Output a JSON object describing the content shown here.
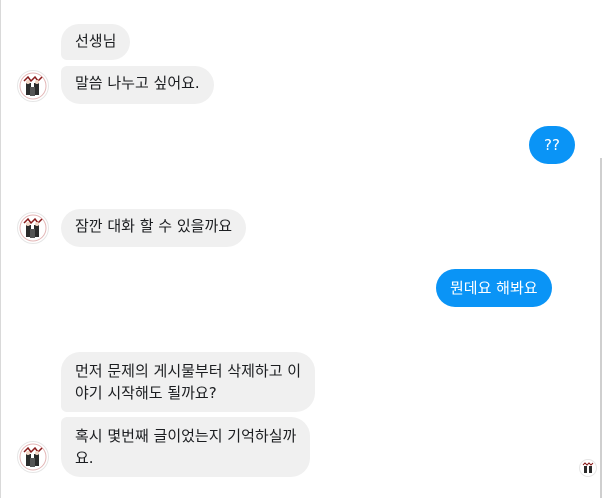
{
  "messages": [
    {
      "from": "them",
      "text": "선생님"
    },
    {
      "from": "them",
      "text": "말씀 나누고 싶어요."
    },
    {
      "from": "me",
      "text": "??"
    },
    {
      "from": "them",
      "text": "잠깐 대화 할 수 있을까요"
    },
    {
      "from": "me",
      "text": "뭔데요 해봐요"
    },
    {
      "from": "them",
      "line1": "먼저 문제의 게시물부터 삭제하고 이",
      "line2": "야기 시작해도 될까요?"
    },
    {
      "from": "them",
      "line1": "혹시 몇번째 글이었는지 기억하실까",
      "line2": "요."
    }
  ],
  "icons": {
    "avatar": "contact-avatar-icon",
    "seen": "read-receipt-avatar-icon"
  },
  "colors": {
    "incoming_bubble": "#f0f0f0",
    "outgoing_bubble": "#0a94f6",
    "text_dark": "#1c1e21",
    "text_light": "#ffffff"
  }
}
